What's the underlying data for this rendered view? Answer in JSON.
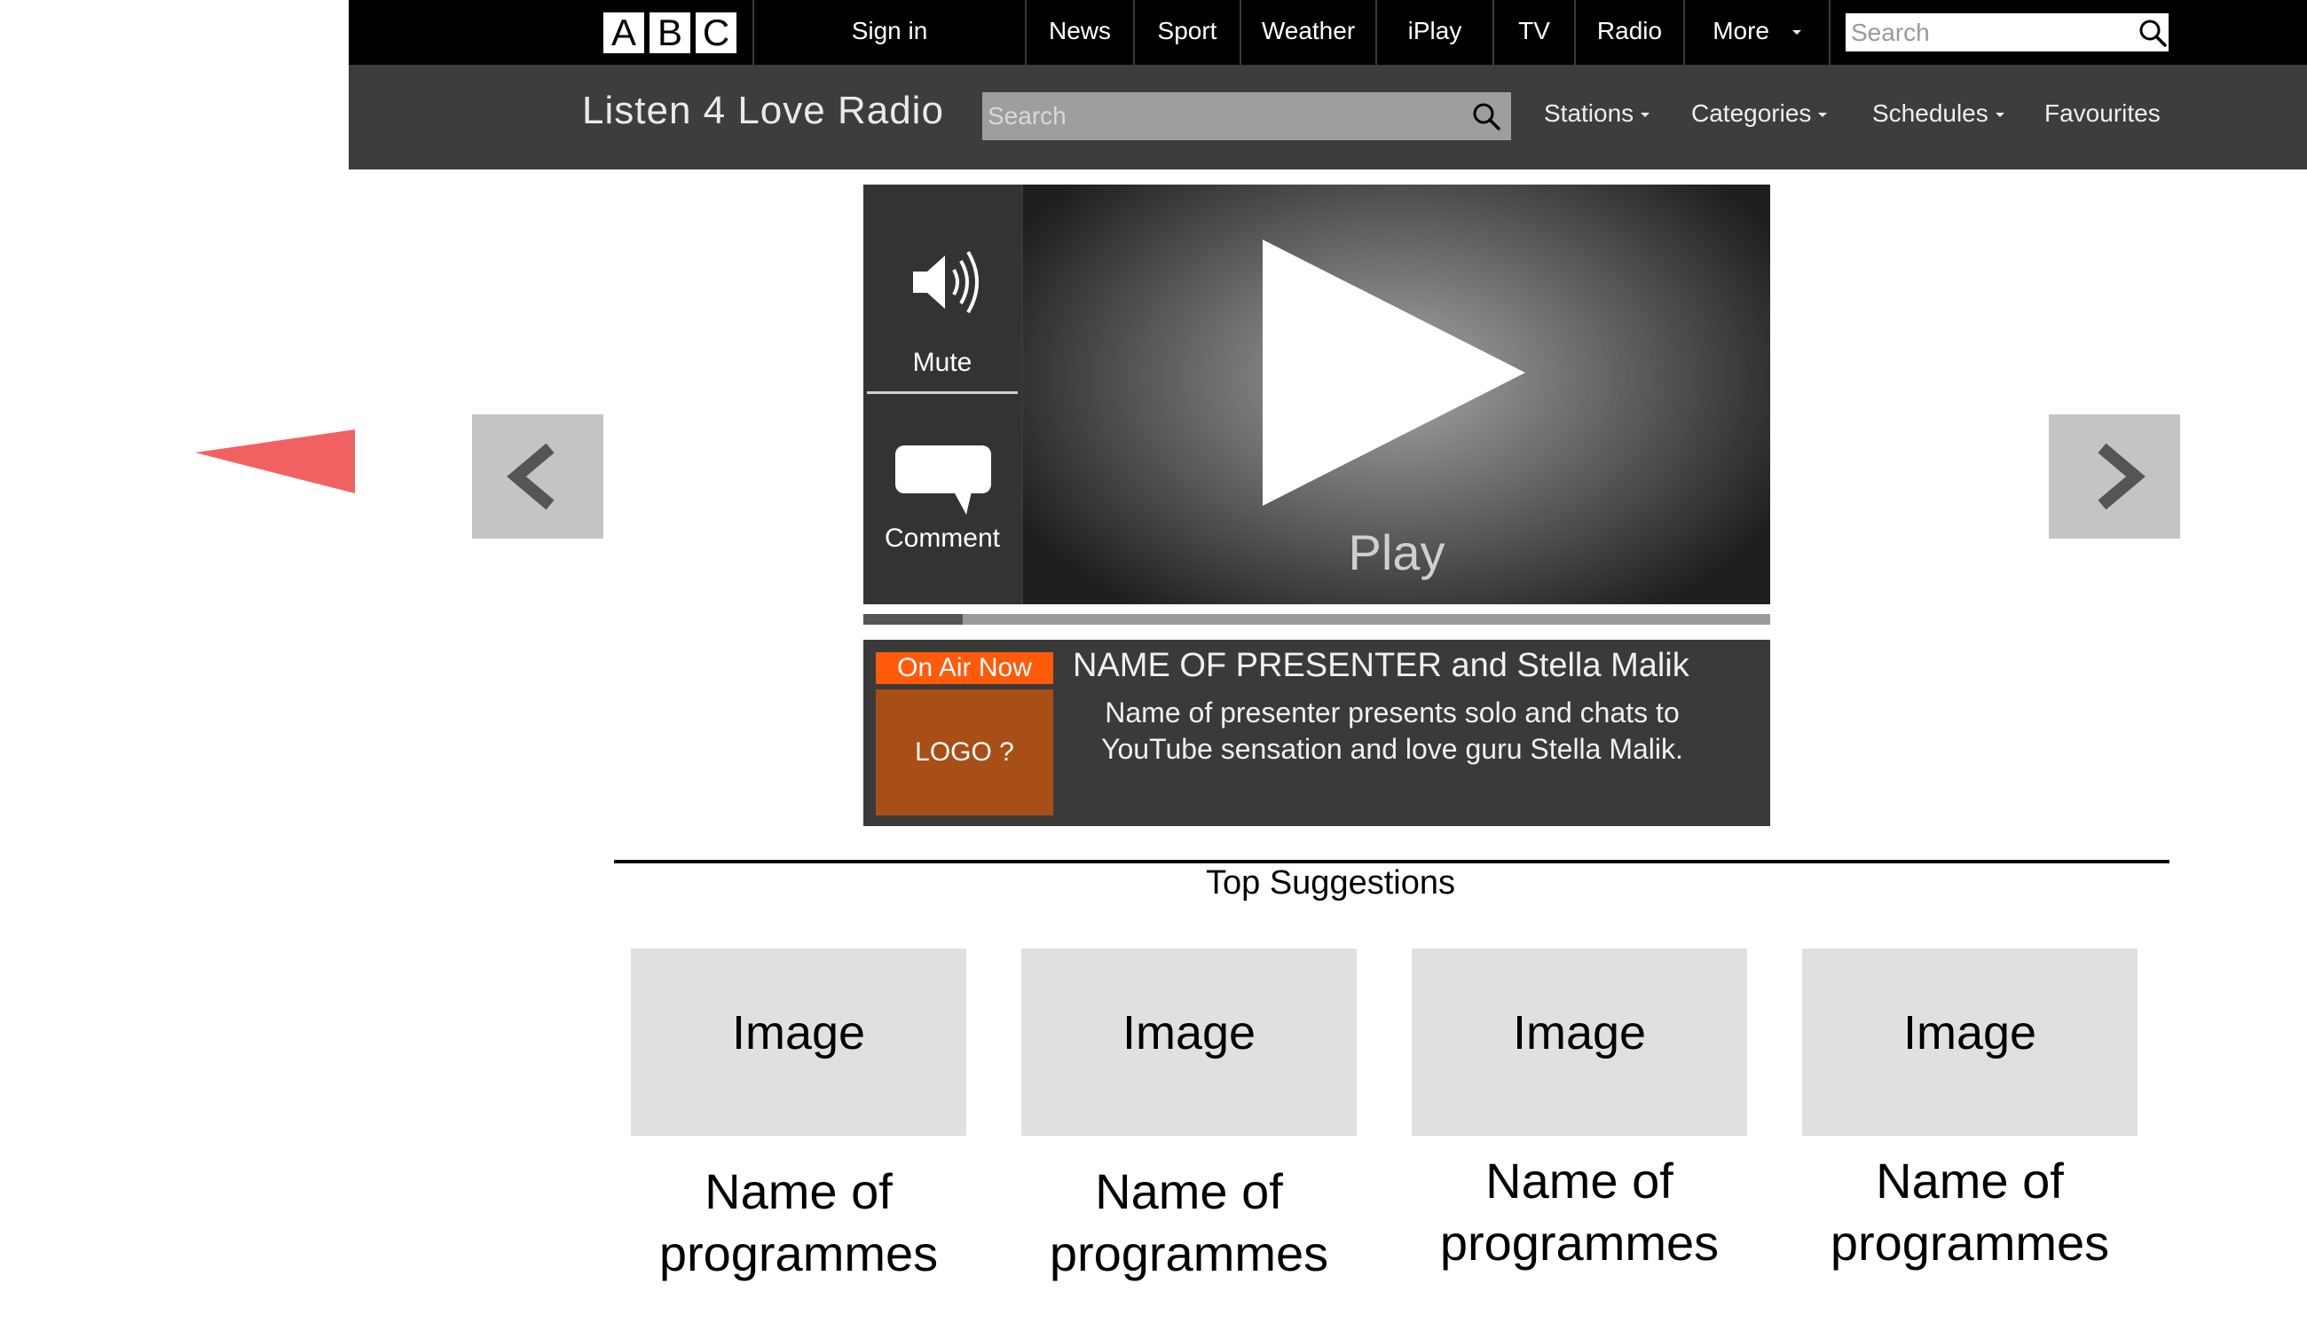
{
  "brand": {
    "logo_letters": [
      "A",
      "B",
      "C"
    ]
  },
  "topnav": {
    "sign_in": "Sign in",
    "links": [
      "News",
      "Sport",
      "Weather",
      "iPlay",
      "TV",
      "Radio",
      "More"
    ],
    "search_placeholder": "Search"
  },
  "subnav": {
    "station_title": "Listen 4 Love Radio",
    "search_placeholder": "Search",
    "stations": "Stations",
    "categories": "Categories",
    "schedules": "Schedules",
    "favourites": "Favourites"
  },
  "player": {
    "mute_label": "Mute",
    "comment_label": "Comment",
    "play_label": "Play",
    "progress_fraction": 0.11
  },
  "on_air": {
    "tag": "On Air Now",
    "logo_text": "LOGO ?",
    "title": "NAME OF PRESENTER and Stella Malik",
    "description": "Name of presenter presents solo and chats to  YouTube sensation and love guru Stella Malik."
  },
  "suggestions": {
    "heading": "Top Suggestions",
    "items": [
      {
        "image": "Image",
        "name": "Name of programmes"
      },
      {
        "image": "Image",
        "name": "Name of programmes"
      },
      {
        "image": "Image",
        "name": "Name of programmes"
      },
      {
        "image": "Image",
        "name": "Name of programmes"
      }
    ]
  },
  "colors": {
    "top_bar": "#000000",
    "sub_bar": "#3d3d3d",
    "on_air_tag": "#ff5a0a",
    "on_air_logo": "#a84e17",
    "pointer": "#f26161"
  },
  "icons": [
    "search-icon",
    "speaker-icon",
    "speech-bubble-icon",
    "play-icon",
    "chevron-left-icon",
    "chevron-right-icon",
    "pointer-arrow-icon"
  ]
}
